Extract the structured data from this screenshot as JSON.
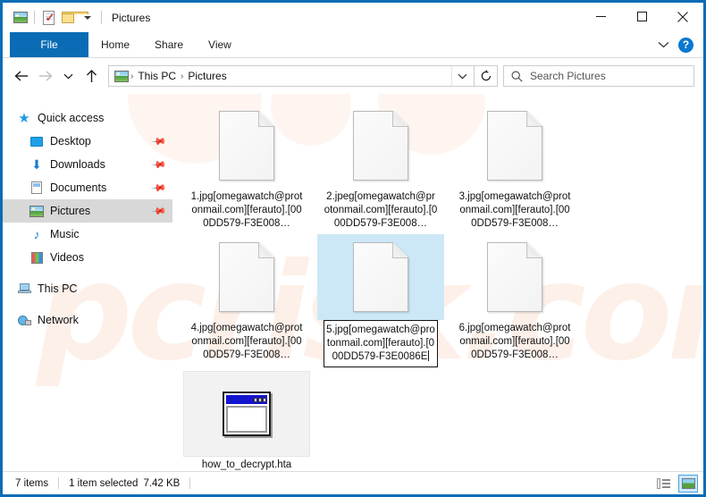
{
  "window": {
    "title": "Pictures",
    "quick_access_toolbar": [
      {
        "name": "pictures-icon",
        "label": "Pictures"
      },
      {
        "name": "properties-icon",
        "label": "Properties"
      },
      {
        "name": "new-folder-icon",
        "label": "New folder"
      },
      {
        "name": "customize-dropdown-icon",
        "label": "Customize Quick Access Toolbar"
      }
    ],
    "controls": {
      "minimize": "Minimize",
      "maximize": "Maximize",
      "close": "Close"
    }
  },
  "ribbon": {
    "tabs": [
      {
        "label": "File",
        "selected": true
      },
      {
        "label": "Home",
        "selected": false
      },
      {
        "label": "Share",
        "selected": false
      },
      {
        "label": "View",
        "selected": false
      }
    ],
    "expand_label": "Expand the Ribbon",
    "help_label": "?"
  },
  "address": {
    "back_label": "Back",
    "forward_label": "Forward",
    "recent_label": "Recent locations",
    "up_label": "Up",
    "breadcrumbs": [
      "This PC",
      "Pictures"
    ],
    "separator": "›",
    "dropdown_label": "Previous locations",
    "refresh_label": "Refresh"
  },
  "search": {
    "placeholder": "Search Pictures",
    "value": "",
    "icon": "search-icon"
  },
  "sidebar": {
    "items": [
      {
        "label": "Quick access",
        "icon": "star-icon",
        "indent": false,
        "pinned": false,
        "selected": false
      },
      {
        "label": "Desktop",
        "icon": "desktop-icon",
        "indent": true,
        "pinned": true,
        "selected": false
      },
      {
        "label": "Downloads",
        "icon": "downloads-icon",
        "indent": true,
        "pinned": true,
        "selected": false
      },
      {
        "label": "Documents",
        "icon": "documents-icon",
        "indent": true,
        "pinned": true,
        "selected": false
      },
      {
        "label": "Pictures",
        "icon": "pictures-icon",
        "indent": true,
        "pinned": true,
        "selected": true
      },
      {
        "label": "Music",
        "icon": "music-icon",
        "indent": true,
        "pinned": false,
        "selected": false
      },
      {
        "label": "Videos",
        "icon": "videos-icon",
        "indent": true,
        "pinned": false,
        "selected": false
      },
      {
        "label": "This PC",
        "icon": "this-pc-icon",
        "indent": false,
        "pinned": false,
        "selected": false
      },
      {
        "label": "Network",
        "icon": "network-icon",
        "indent": false,
        "pinned": false,
        "selected": false
      }
    ],
    "pin_glyph": "📌"
  },
  "files": [
    {
      "name": "1.jpg[omegawatch@protonmail.com][ferauto].[000DD579-F3E008…",
      "icon": "blank-document-icon",
      "state": "normal"
    },
    {
      "name": "2.jpeg[omegawatch@protonmail.com][ferauto].[000DD579-F3E008…",
      "icon": "blank-document-icon",
      "state": "normal"
    },
    {
      "name": "3.jpg[omegawatch@protonmail.com][ferauto].[000DD579-F3E008…",
      "icon": "blank-document-icon",
      "state": "normal"
    },
    {
      "name": "4.jpg[omegawatch@protonmail.com][ferauto].[000DD579-F3E008…",
      "icon": "blank-document-icon",
      "state": "normal"
    },
    {
      "name": "5.jpg[omegawatch@protonmail.com][ferauto].[000DD579-F3E0086E",
      "icon": "blank-document-icon",
      "state": "selected-renaming"
    },
    {
      "name": "6.jpg[omegawatch@protonmail.com][ferauto].[000DD579-F3E008…",
      "icon": "blank-document-icon",
      "state": "normal"
    },
    {
      "name": "how_to_decrypt.hta",
      "icon": "hta-application-icon",
      "state": "hover"
    }
  ],
  "status": {
    "item_count": "7 items",
    "selection": "1 item selected",
    "size": "7.42 KB",
    "view_details_label": "Details view",
    "view_large_label": "Large icons view"
  },
  "colors": {
    "window_frame": "#0b6cb5",
    "file_tab": "#0b6cb5",
    "selection": "#cce8f7",
    "sidebar_selection": "#d8d8d8",
    "hta_titlebar": "#1414cf"
  },
  "watermark": {
    "text": "pcrisk.com"
  }
}
